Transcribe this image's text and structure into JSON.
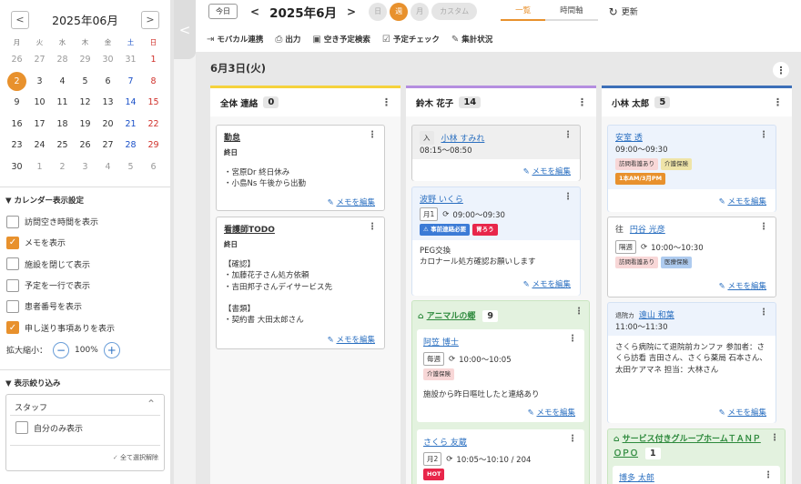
{
  "calendar": {
    "month_title": "2025年06月",
    "weekdays": [
      "月",
      "火",
      "水",
      "木",
      "金",
      "土",
      "日"
    ],
    "weeks": [
      [
        "26",
        "27",
        "28",
        "29",
        "30",
        "31",
        "1"
      ],
      [
        "2",
        "3",
        "4",
        "5",
        "6",
        "7",
        "8"
      ],
      [
        "9",
        "10",
        "11",
        "12",
        "13",
        "14",
        "15"
      ],
      [
        "16",
        "17",
        "18",
        "19",
        "20",
        "21",
        "22"
      ],
      [
        "23",
        "24",
        "25",
        "26",
        "27",
        "28",
        "29"
      ],
      [
        "30",
        "1",
        "2",
        "3",
        "4",
        "5",
        "6"
      ]
    ]
  },
  "settings": {
    "title": "カレンダー表示設定",
    "options": [
      {
        "label": "訪問空き時間を表示",
        "checked": false
      },
      {
        "label": "メモを表示",
        "checked": true
      },
      {
        "label": "施設を閉じて表示",
        "checked": false
      },
      {
        "label": "予定を一行で表示",
        "checked": false
      },
      {
        "label": "患者番号を表示",
        "checked": false
      },
      {
        "label": "申し送り事項ありを表示",
        "checked": true
      }
    ],
    "zoom_label": "拡大縮小：",
    "zoom_value": "100%"
  },
  "filter": {
    "title": "表示絞り込み",
    "staff_label": "スタッフ",
    "self_only": "自分のみ表示",
    "deselect_all": "全て選択解除"
  },
  "toolbar": {
    "today": "今日",
    "date": "2025年6月",
    "views": [
      "日",
      "週",
      "月"
    ],
    "custom": "カスタム",
    "list_tab": "一覧",
    "time_tab": "時間軸",
    "refresh": "更新"
  },
  "tools": [
    "モバカル連携",
    "出力",
    "空き予定検索",
    "予定チェック",
    "集計状況"
  ],
  "main": {
    "date_header": "6月3日(火)",
    "columns": [
      {
        "name": "全体 連絡",
        "count": "0",
        "color": "#f5d23c",
        "cards": [
          {
            "title": "勤怠",
            "when": "終日",
            "body": "・宮原Dr 終日休み\n・小島Ns 午後から出勤",
            "memo": "メモを編集"
          },
          {
            "title": "看護師TODO",
            "when": "終日",
            "body": "【確認】\n・加藤花子さん処方依頼\n・吉田邦子さんデイサービス先\n\n【書類】\n・契約書 大田太郎さん",
            "memo": "メモを編集"
          }
        ]
      },
      {
        "name": "鈴木 花子",
        "count": "14",
        "color": "#b48ee0",
        "cards": [
          {
            "badge": "入",
            "title": "小林 すみれ",
            "time": "08:15〜08:50",
            "memo": "メモを編集"
          },
          {
            "title": "波野 いくら",
            "badge": "月1",
            "time": "09:00〜09:30",
            "tags": [
              "事前連絡必要",
              "胃ろう"
            ],
            "body": "PEG交換\nカロナール処方確認お願いします",
            "memo": "メモを編集"
          }
        ],
        "group": {
          "name": "アニマルの郷",
          "count": "9",
          "cards": [
            {
              "title": "阿笠 博士",
              "badge": "毎週",
              "time": "10:00〜10:05",
              "tags": [
                "介護保険"
              ],
              "body": "施設から昨日嘔吐したと連絡あり",
              "memo": "メモを編集"
            },
            {
              "title": "さくら 友蔵",
              "badge": "月2",
              "time": "10:05〜10:10 / 204",
              "tags": [
                "HOT"
              ]
            }
          ]
        }
      },
      {
        "name": "小林 太郎",
        "count": "5",
        "color": "#3c6fb8",
        "cards": [
          {
            "title": "安室 透",
            "time": "09:00〜09:30",
            "tags": [
              "訪問看護あり",
              "介護保険",
              "1本AM/3月PM"
            ],
            "memo": "メモを編集"
          },
          {
            "prefix": "往",
            "title": "円谷 光彦",
            "badge": "隔週",
            "time": "10:00〜10:30",
            "tags": [
              "訪問看護あり",
              "医療保険"
            ],
            "memo": "メモを編集"
          },
          {
            "prefix": "退院カ",
            "title": "遠山 和葉",
            "time": "11:00〜11:30",
            "body": "さくら病院にて退院前カンファ\n\n参加者：さくら訪看 吉田さん、さくら薬局 石本さん、太田ケアマネ\n担当：大林さん",
            "memo": "メモを編集"
          }
        ],
        "group": {
          "name": "サービス付きグループホームＴＡＮＰＯＰＯ",
          "count": "1",
          "cards": [
            {
              "title": "博多 太郎"
            }
          ]
        }
      }
    ]
  }
}
